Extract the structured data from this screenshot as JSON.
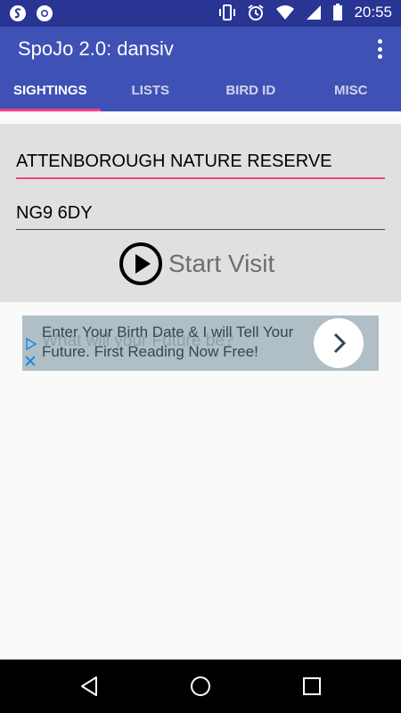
{
  "status_bar": {
    "time": "20:55"
  },
  "app_bar": {
    "title": "SpoJo 2.0: dansiv"
  },
  "tabs": [
    "SIGHTINGS",
    "LISTS",
    "BIRD ID",
    "MISC"
  ],
  "active_tab": "SIGHTINGS",
  "visit": {
    "location": "ATTENBOROUGH NATURE RESERVE",
    "postcode": "NG9 6DY",
    "start_label": "Start Visit"
  },
  "ad": {
    "line1": "Enter Your Birth Date & I will Tell Your",
    "line2": "Future. First Reading Now Free!",
    "ghost_text": "What will your Future be?"
  },
  "colors": {
    "primary": "#3f51b5",
    "status_bar": "#283593",
    "accent": "#ff4081"
  }
}
